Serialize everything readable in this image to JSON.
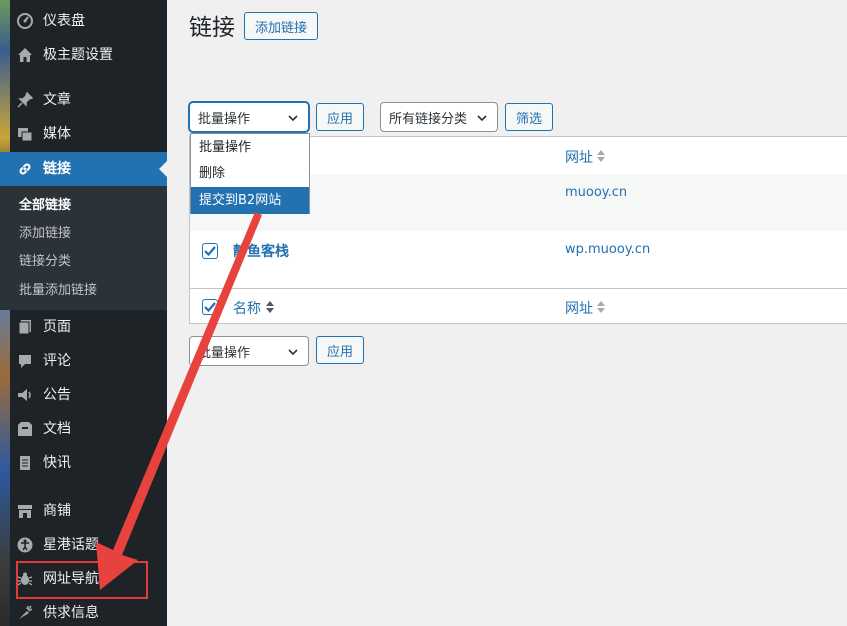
{
  "sidebar": {
    "items": [
      {
        "label": "仪表盘",
        "icon": "dashboard-icon"
      },
      {
        "label": "极主题设置",
        "icon": "home-icon"
      },
      {
        "label": "文章",
        "icon": "pin-icon"
      },
      {
        "label": "媒体",
        "icon": "media-icon"
      },
      {
        "label": "链接",
        "icon": "link-icon"
      },
      {
        "label": "页面",
        "icon": "page-icon"
      },
      {
        "label": "评论",
        "icon": "comment-icon"
      },
      {
        "label": "公告",
        "icon": "megaphone-icon"
      },
      {
        "label": "文档",
        "icon": "archive-icon"
      },
      {
        "label": "快讯",
        "icon": "document-icon"
      },
      {
        "label": "商铺",
        "icon": "store-icon"
      },
      {
        "label": "星港话题",
        "icon": "universal-access-icon"
      },
      {
        "label": "网址导航",
        "icon": "bug-icon"
      },
      {
        "label": "供求信息",
        "icon": "carrot-icon"
      }
    ],
    "submenu": [
      "全部链接",
      "添加链接",
      "链接分类",
      "批量添加链接"
    ]
  },
  "header": {
    "title": "链接",
    "add_button": "添加链接"
  },
  "toolbar": {
    "bulk_select": "批量操作",
    "apply": "应用",
    "category_select": "所有链接分类",
    "filter": "筛选"
  },
  "dropdown": {
    "options": [
      "批量操作",
      "删除",
      "提交到B2网站"
    ],
    "selected_index": 2
  },
  "table": {
    "columns": {
      "name": "名称",
      "url": "网址"
    },
    "rows": [
      {
        "name": "",
        "url": "muooy.cn",
        "checked": true
      },
      {
        "name": "静鱼客栈",
        "url": "wp.muooy.cn",
        "checked": true
      }
    ]
  },
  "bottom_toolbar": {
    "bulk_select": "批量操作",
    "apply": "应用"
  },
  "colors": {
    "accent": "#2271b1",
    "sidebar_bg": "#1d2327",
    "annotation_red": "#e33b3b"
  }
}
